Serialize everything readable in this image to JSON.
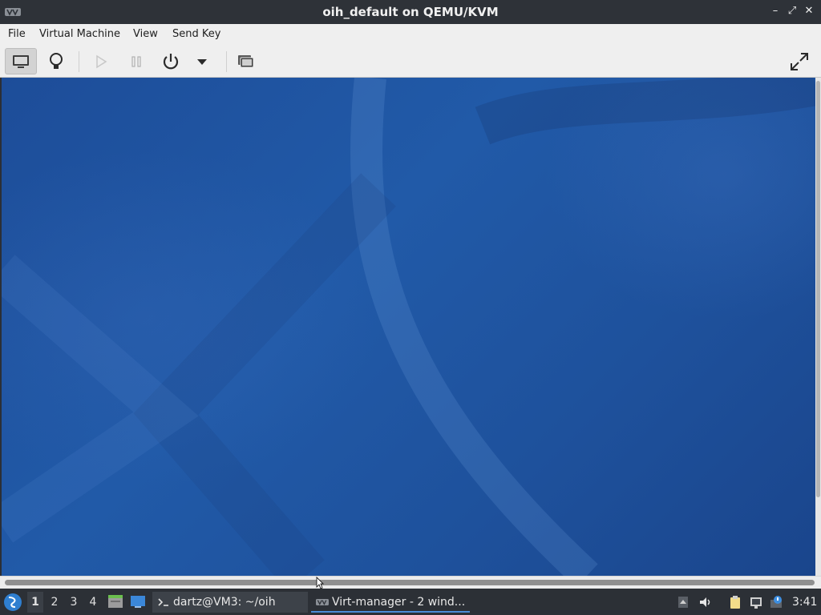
{
  "window": {
    "title": "oih_default on QEMU/KVM",
    "controls": {
      "minimize": "–",
      "maximize": "⤢",
      "close": "✕"
    }
  },
  "menubar": {
    "items": [
      "File",
      "Virtual Machine",
      "View",
      "Send Key"
    ]
  },
  "toolbar": {
    "buttons": [
      "monitor-icon",
      "lightbulb-icon",
      "run-icon",
      "pause-icon",
      "power-icon",
      "dropdown-icon",
      "snapshot-icon",
      "fullscreen-icon"
    ]
  },
  "taskbar": {
    "workspaces": [
      "1",
      "2",
      "3",
      "4"
    ],
    "active_workspace": "1",
    "tasks": [
      {
        "label": "dartz@VM3: ~/oih"
      },
      {
        "label": "Virt-manager - 2 wind..."
      }
    ],
    "clock": "3:41"
  },
  "colors": {
    "accent": "#4a8dd8",
    "desktop": "#215aa8"
  }
}
